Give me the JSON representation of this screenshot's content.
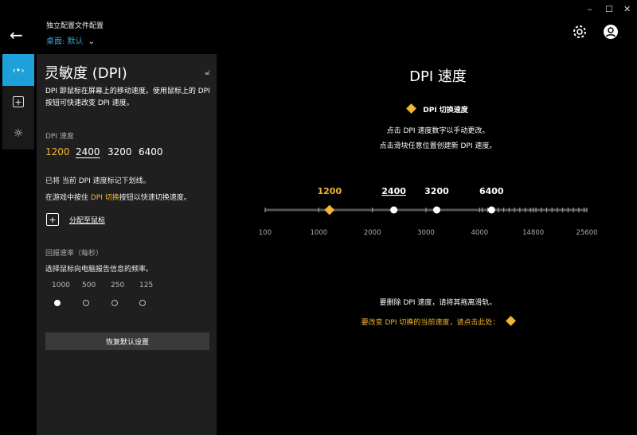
{
  "header": {
    "profile_title": "独立配置文件配置",
    "profile_selected": "桌面: 默认"
  },
  "window": {
    "minimize": "–",
    "maximize": "☐",
    "close": "✕"
  },
  "panel": {
    "title": "灵敏度 (DPI)",
    "description": "DPI 即鼠标在屏幕上的移动速度。使用鼠标上的 DPI 按钮可快速改变 DPI 速度。",
    "dpi_label": "DPI 速度",
    "dpi_values": [
      "1200",
      "2400",
      "3200",
      "6400"
    ],
    "note1": "已将 当前 DPI 速度标记下划线。",
    "note2_pre": "在游戏中按住 ",
    "note2_hl": "DPI 切换",
    "note2_post": "按钮以快速切换速度。",
    "assign": "分配至鼠标",
    "report_label": "回报速率（每秒）",
    "report_desc": "选择鼠标向电脑报告信息的频率。",
    "report_rates": [
      "1000",
      "500",
      "250",
      "125"
    ],
    "report_selected": "1000",
    "reset": "恢复默认设置"
  },
  "main": {
    "title": "DPI 速度",
    "legend": "DPI 切换速度",
    "hint1": "点击 DPI 速度数字以手动更改。",
    "hint2": "点击滑块任意位置创建新 DPI 速度。",
    "hint3": "要删除 DPI 速度，请将其拖离滑轨。",
    "hint4": "要改变 DPI 切换的当前速度，请点击此处："
  },
  "colors": {
    "accent": "#1ea0db",
    "shift": "#f2b632"
  },
  "chart_data": {
    "type": "scatter",
    "axis_ticks": [
      100,
      1000,
      2000,
      3000,
      4000,
      14800,
      25600
    ],
    "tick_labels": [
      "100",
      "1000",
      "2000",
      "3000",
      "4000",
      "14800",
      "25600"
    ],
    "markers": [
      {
        "value": 1200,
        "label": "1200",
        "shift": true,
        "current": false
      },
      {
        "value": 2400,
        "label": "2400",
        "shift": false,
        "current": true
      },
      {
        "value": 3200,
        "label": "3200",
        "shift": false,
        "current": false
      },
      {
        "value": 6400,
        "label": "6400",
        "shift": false,
        "current": false
      }
    ]
  }
}
